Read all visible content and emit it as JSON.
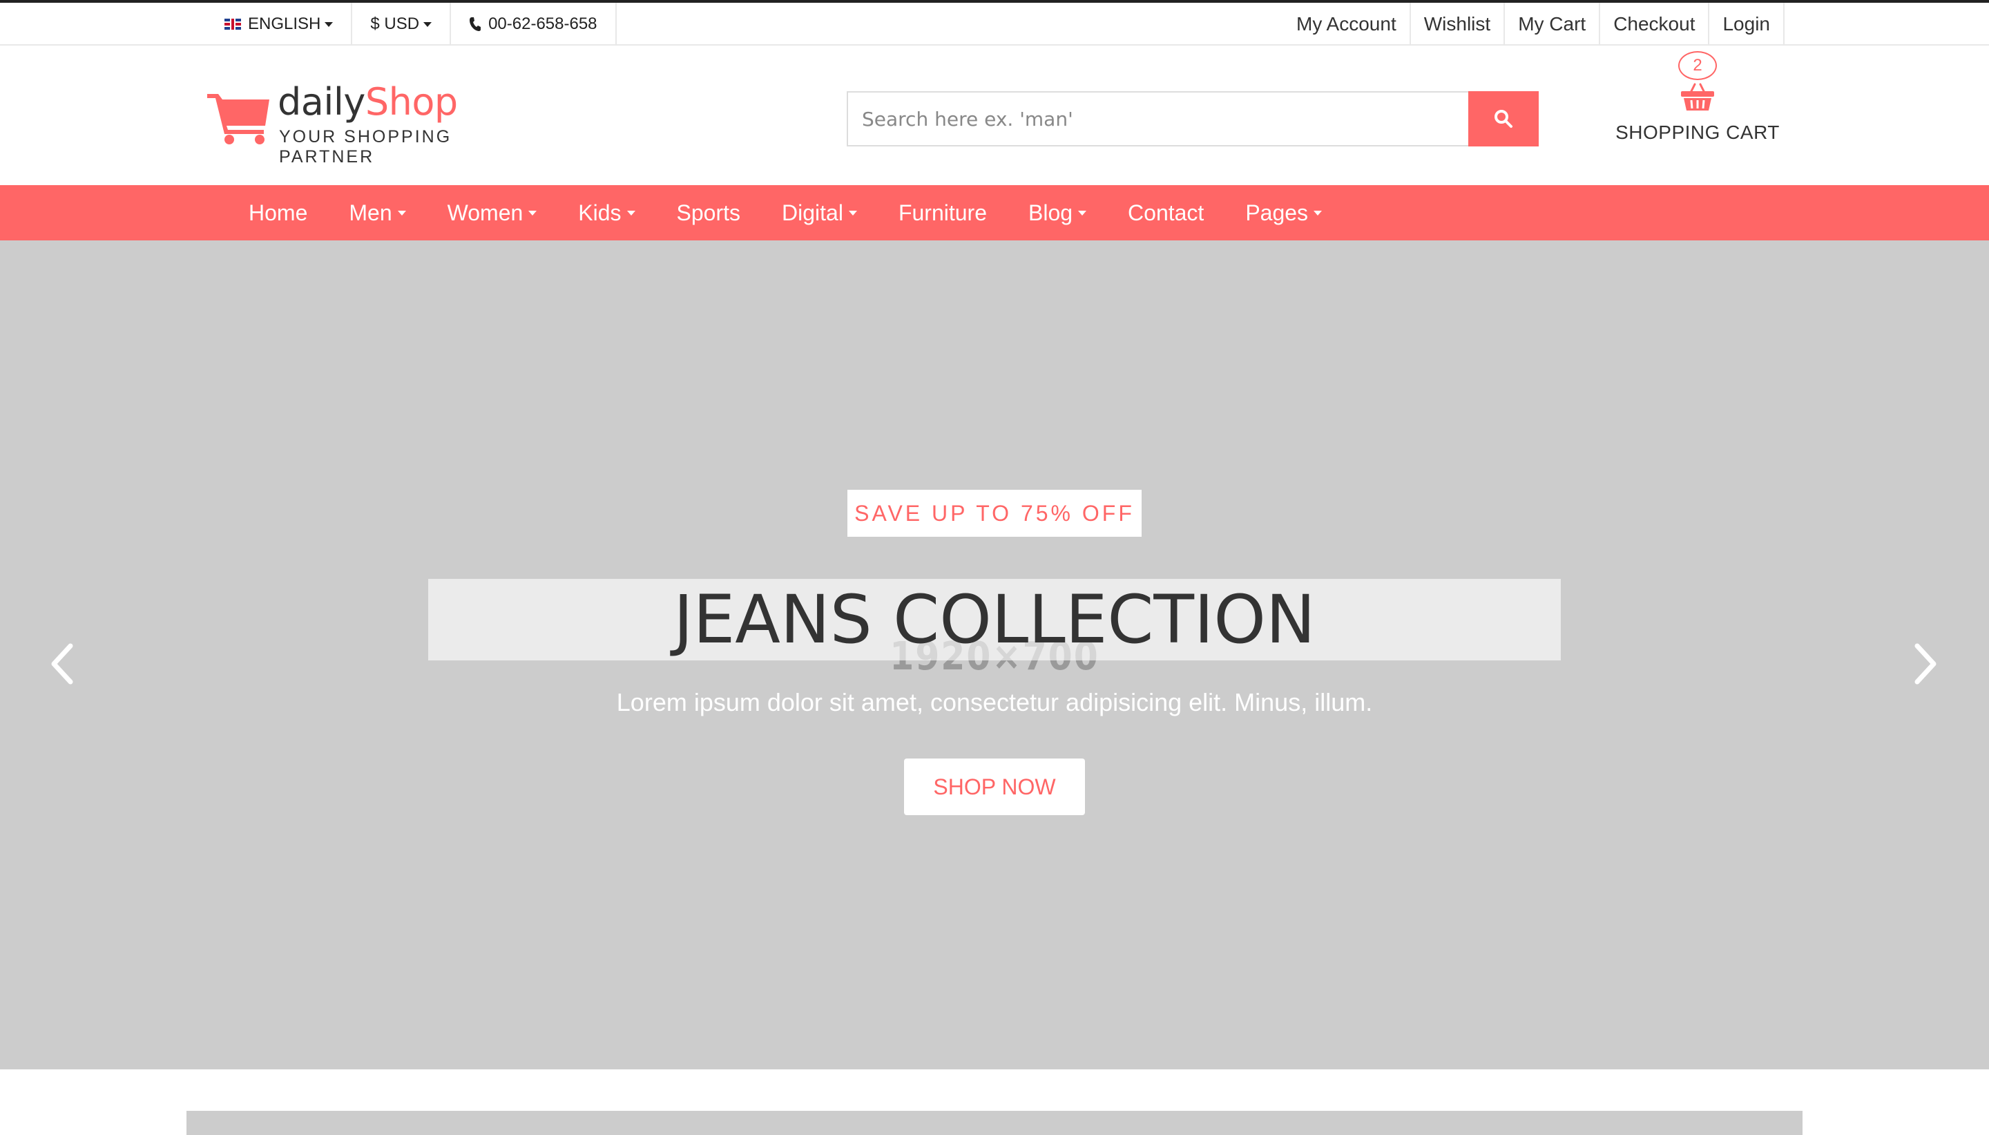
{
  "topbar": {
    "language": "ENGLISH",
    "currency": "$ USD",
    "phone": "00-62-658-658",
    "links": [
      "My Account",
      "Wishlist",
      "My Cart",
      "Checkout",
      "Login"
    ]
  },
  "header": {
    "logo_primary": "daily",
    "logo_accent": "Shop",
    "tagline": "YOUR SHOPPING PARTNER",
    "search_placeholder": "Search here ex. 'man'",
    "cart_count": "2",
    "cart_label": "SHOPPING CART"
  },
  "nav": {
    "items": [
      {
        "label": "Home",
        "dropdown": false
      },
      {
        "label": "Men",
        "dropdown": true
      },
      {
        "label": "Women",
        "dropdown": true
      },
      {
        "label": "Kids",
        "dropdown": true
      },
      {
        "label": "Sports",
        "dropdown": false
      },
      {
        "label": "Digital",
        "dropdown": true
      },
      {
        "label": "Furniture",
        "dropdown": false
      },
      {
        "label": "Blog",
        "dropdown": true
      },
      {
        "label": "Contact",
        "dropdown": false
      },
      {
        "label": "Pages",
        "dropdown": true
      }
    ]
  },
  "hero": {
    "placeholder": "1920×700",
    "promo": "SAVE UP TO 75% OFF",
    "headline": "JEANS COLLECTION",
    "subline": "Lorem ipsum dolor sit amet, consectetur adipisicing elit. Minus, illum.",
    "button": "SHOP NOW"
  },
  "colors": {
    "accent": "#ff6666",
    "hero_bg": "#cccccc"
  }
}
